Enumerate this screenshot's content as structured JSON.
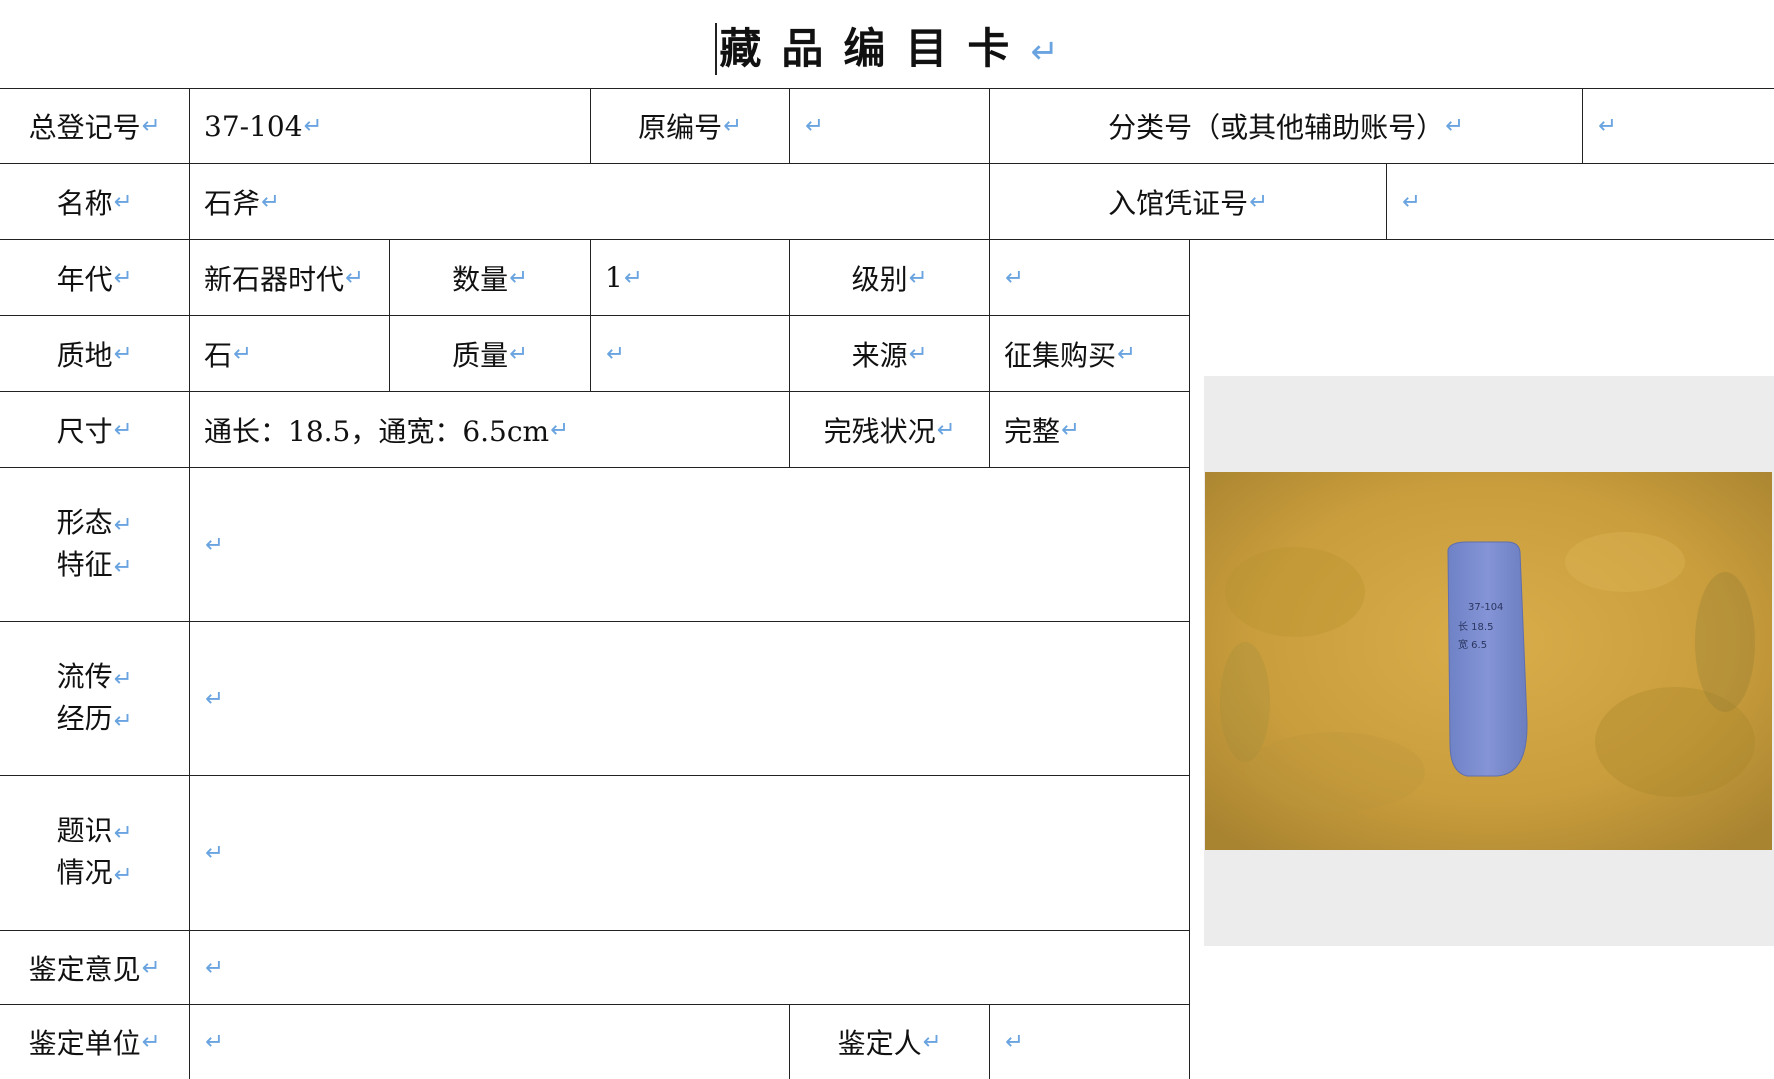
{
  "title": "藏品编目卡",
  "para_mark": "↵",
  "rows": {
    "r1": {
      "total_reg_label": "总登记号",
      "total_reg_value": "37-104",
      "orig_no_label": "原编号",
      "orig_no_value": "",
      "class_no_label": "分类号（或其他辅助账号）",
      "class_no_value": ""
    },
    "r2": {
      "name_label": "名称",
      "name_value": "石斧",
      "voucher_label": "入馆凭证号",
      "voucher_value": ""
    },
    "r3": {
      "era_label": "年代",
      "era_value": "新石器时代",
      "qty_label": "数量",
      "qty_value": "1",
      "grade_label": "级别",
      "grade_value": ""
    },
    "r4": {
      "material_label": "质地",
      "material_value": "石",
      "mass_label": "质量",
      "mass_value": "",
      "source_label": "来源",
      "source_value": "征集购买"
    },
    "r5": {
      "size_label": "尺寸",
      "size_value": "通长：18.5，通宽：6.5cm",
      "cond_label": "完残状况",
      "cond_value": "完整"
    },
    "r6": {
      "label_1": "形态",
      "label_2": "特征",
      "value": ""
    },
    "r7": {
      "label_1": "流传",
      "label_2": "经历",
      "value": ""
    },
    "r8": {
      "label_1": "题识",
      "label_2": "情况",
      "value": ""
    },
    "r9": {
      "label": "鉴定意见",
      "value": ""
    },
    "r10": {
      "unit_label": "鉴定单位",
      "unit_value": "",
      "person_label": "鉴定人",
      "person_value": ""
    }
  },
  "photo": {
    "icon": "stone-axe-photo",
    "inscription_1": "37-104",
    "inscription_2": "长 18.5",
    "inscription_3": "宽 6.5",
    "colors": {
      "background": "#c9a23f",
      "axe": "#7d8fd0"
    }
  }
}
